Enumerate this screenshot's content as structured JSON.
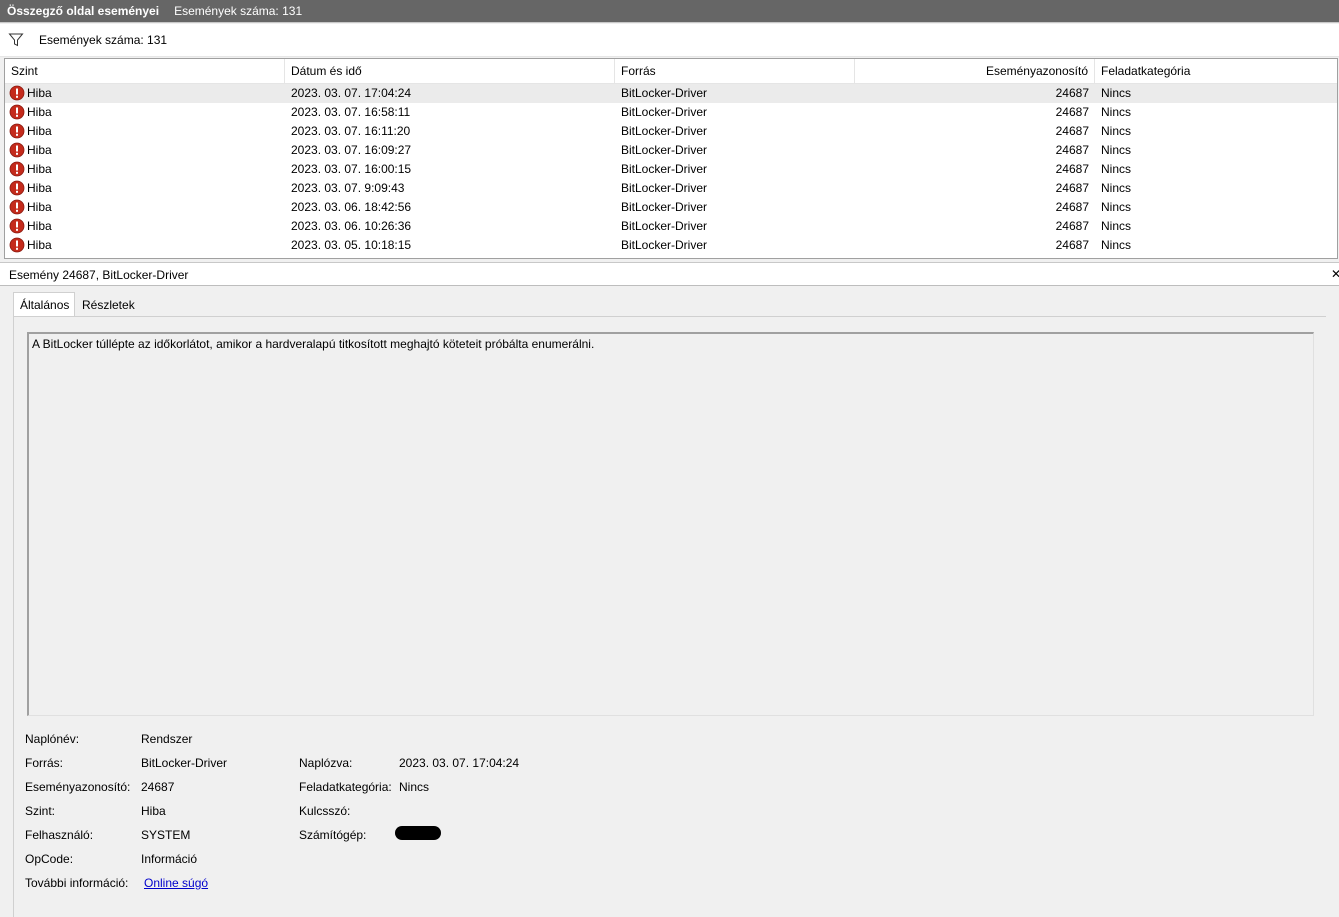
{
  "titlebar": {
    "title": "Összegző oldal eseményei",
    "count": "Események száma: 131"
  },
  "filterbar": {
    "icon": "funnel-icon",
    "count": "Események száma: 131"
  },
  "columns": [
    "Szint",
    "Dátum és idő",
    "Forrás",
    "Eseményazonosító",
    "Feladatkategória"
  ],
  "rows": [
    {
      "level": "Hiba",
      "date": "2023. 03. 07. 17:04:24",
      "source": "BitLocker-Driver",
      "id": "24687",
      "category": "Nincs"
    },
    {
      "level": "Hiba",
      "date": "2023. 03. 07. 16:58:11",
      "source": "BitLocker-Driver",
      "id": "24687",
      "category": "Nincs"
    },
    {
      "level": "Hiba",
      "date": "2023. 03. 07. 16:11:20",
      "source": "BitLocker-Driver",
      "id": "24687",
      "category": "Nincs"
    },
    {
      "level": "Hiba",
      "date": "2023. 03. 07. 16:09:27",
      "source": "BitLocker-Driver",
      "id": "24687",
      "category": "Nincs"
    },
    {
      "level": "Hiba",
      "date": "2023. 03. 07. 16:00:15",
      "source": "BitLocker-Driver",
      "id": "24687",
      "category": "Nincs"
    },
    {
      "level": "Hiba",
      "date": "2023. 03. 07. 9:09:43",
      "source": "BitLocker-Driver",
      "id": "24687",
      "category": "Nincs"
    },
    {
      "level": "Hiba",
      "date": "2023. 03. 06. 18:42:56",
      "source": "BitLocker-Driver",
      "id": "24687",
      "category": "Nincs"
    },
    {
      "level": "Hiba",
      "date": "2023. 03. 06. 10:26:36",
      "source": "BitLocker-Driver",
      "id": "24687",
      "category": "Nincs"
    },
    {
      "level": "Hiba",
      "date": "2023. 03. 05. 10:18:15",
      "source": "BitLocker-Driver",
      "id": "24687",
      "category": "Nincs"
    }
  ],
  "detail": {
    "header": "Esemény 24687, BitLocker-Driver",
    "close": "✕",
    "tabs": [
      "Általános",
      "Részletek"
    ],
    "description": "A BitLocker túllépte az időkorlátot, amikor a hardveralapú titkosított meghajtó köteteit próbálta enumerálni.",
    "props": {
      "log_label": "Naplónév:",
      "log_value": "Rendszer",
      "source_label": "Forrás:",
      "source_value": "BitLocker-Driver",
      "logged_label": "Naplózva:",
      "logged_value": "2023. 03. 07. 17:04:24",
      "id_label": "Eseményazonosító:",
      "id_value": "24687",
      "category_label": "Feladatkategória:",
      "category_value": "Nincs",
      "level_label": "Szint:",
      "level_value": "Hiba",
      "keyword_label": "Kulcsszó:",
      "user_label": "Felhasználó:",
      "user_value": "SYSTEM",
      "computer_label": "Számítógép:",
      "opcode_label": "OpCode:",
      "opcode_value": "Információ",
      "more_label": "További információ:",
      "more_value": "Online súgó"
    }
  },
  "colors": {
    "title_bg": "#666666",
    "error_red": "#c42b1c",
    "link": "#0000cc"
  }
}
